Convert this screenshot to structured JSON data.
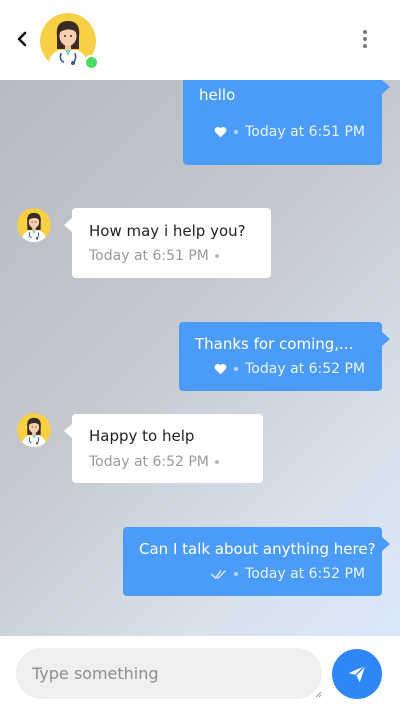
{
  "colors": {
    "accent": "#2f86f6",
    "outgoing_bubble": "#4b9cf8",
    "incoming_bubble": "#ffffff",
    "online": "#4cd964"
  },
  "header": {
    "back_icon": "back-arrow-icon",
    "menu_icon": "more-vertical-icon",
    "contact_status": "online"
  },
  "messages": [
    {
      "direction": "outgoing",
      "text": "hello",
      "time": "Today at 6:51 PM",
      "status_icon": "heart-icon"
    },
    {
      "direction": "incoming",
      "text": "How may i help you?",
      "time": "Today at 6:51 PM"
    },
    {
      "direction": "outgoing",
      "text": "Thanks for coming,...",
      "time": "Today at 6:52 PM",
      "status_icon": "heart-icon"
    },
    {
      "direction": "incoming",
      "text": "Happy to help",
      "time": "Today at 6:52 PM"
    },
    {
      "direction": "outgoing",
      "text": "Can I talk about anything here?",
      "time": "Today at 6:52 PM",
      "status_icon": "double-check-icon"
    }
  ],
  "composer": {
    "placeholder": "Type something",
    "send_icon": "send-icon"
  }
}
